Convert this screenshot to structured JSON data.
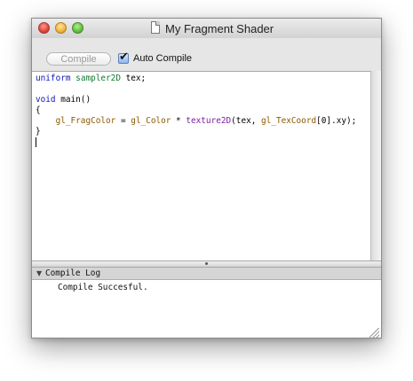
{
  "window": {
    "title": "My Fragment Shader"
  },
  "toolbar": {
    "compile_label": "Compile",
    "auto_compile_label": "Auto Compile",
    "auto_compile_checked": true
  },
  "editor": {
    "line1": {
      "kw": "uniform",
      "type": "sampler2D",
      "rest": " tex;"
    },
    "line3": {
      "kw": "void",
      "rest": " main()"
    },
    "line4": "{",
    "line5": {
      "indent": "    ",
      "frag": "gl_FragColor",
      "eq": " = ",
      "color": "gl_Color",
      "mul": " * ",
      "func": "texture2D",
      "args_start": "(tex, ",
      "texcoord": "gl_TexCoord",
      "args_end": "[0].xy);"
    },
    "line6": "}"
  },
  "log": {
    "header": "Compile Log",
    "message": "Compile Succesful."
  },
  "icons": {
    "close": "close-button",
    "minimize": "minimize-button",
    "zoom": "zoom-button",
    "document": "document-icon",
    "disclosure": "disclosure-triangle-icon",
    "resize": "resize-grip-icon"
  },
  "colors": {
    "keyword": "#0c14b8",
    "type": "#0f7a32",
    "builtin": "#8a5a00",
    "function": "#7a1fa2"
  }
}
